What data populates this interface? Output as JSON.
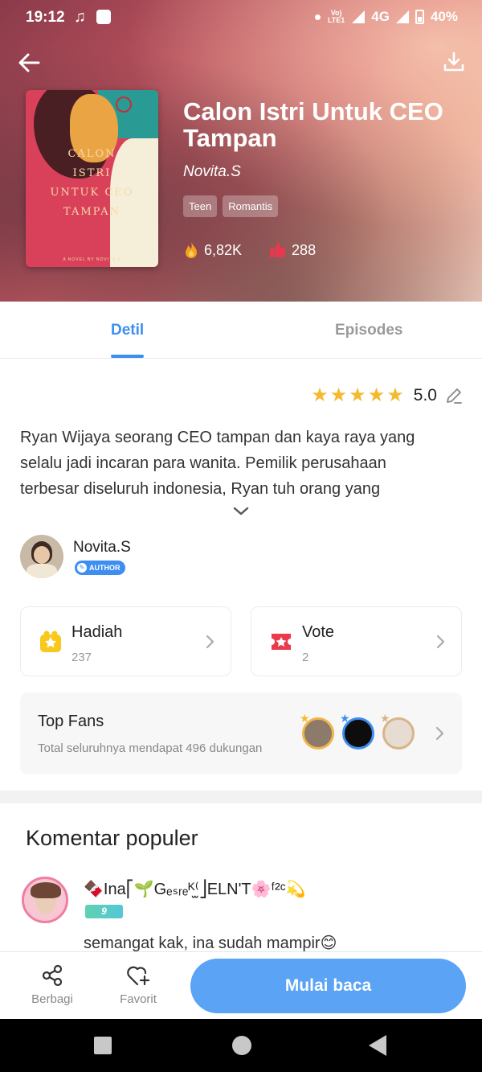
{
  "status_bar": {
    "time": "19:12",
    "network": "4G",
    "battery": "40%",
    "volte_label": "VoLTE1"
  },
  "book": {
    "title": "Calon Istri Untuk CEO Tampan",
    "author": "Novita.S",
    "tags": [
      "Teen",
      "Romantis"
    ],
    "views": "6,82K",
    "likes": "288",
    "cover": {
      "title_lines": [
        "CALON",
        "ISTRI",
        "UNTUK CEO",
        "TAMPAN"
      ],
      "caption": "A NOVEL BY NOVITA S"
    }
  },
  "tabs": {
    "detil": "Detil",
    "episodes": "Episodes"
  },
  "rating": {
    "stars": 5,
    "score": "5.0"
  },
  "synopsis": "Ryan Wijaya seorang CEO tampan dan kaya raya yang selalu jadi incaran para wanita. Pemilik perusahaan terbesar diseluruh indonesia, Ryan tuh orang yang",
  "author_section": {
    "name": "Novita.S",
    "badge": "AUTHOR"
  },
  "cards": {
    "hadiah": {
      "title": "Hadiah",
      "count": "237"
    },
    "vote": {
      "title": "Vote",
      "count": "2"
    }
  },
  "top_fans": {
    "title": "Top Fans",
    "subtitle": "Total seluruhnya mendapat 496 dukungan"
  },
  "comments": {
    "title": "Komentar populer",
    "items": [
      {
        "user": "🍫Ina⎡🌱Gₑₛᵣₑᴷ⁽̫⎦ELN'T🌸ᶠ²ᶜ💫",
        "level": "9",
        "text": "semangat kak, ina sudah mampir😊"
      }
    ]
  },
  "bottom_bar": {
    "share": "Berbagi",
    "favorite": "Favorit",
    "start": "Mulai baca"
  },
  "colors": {
    "accent": "#3d8ef0",
    "button": "#5aa3f5",
    "star": "#f5b92e"
  }
}
